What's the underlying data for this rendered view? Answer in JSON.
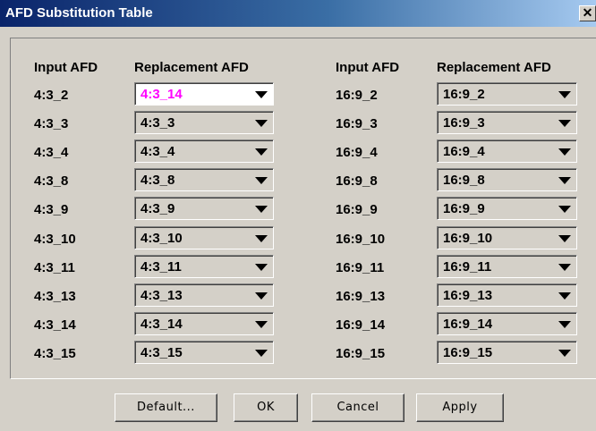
{
  "window": {
    "title": "AFD Substitution Table",
    "close_glyph": "✕"
  },
  "headers": {
    "input_afd": "Input AFD",
    "replacement_afd": "Replacement AFD"
  },
  "left_rows": [
    {
      "input": "4:3_2",
      "replacement": "4:3_14"
    },
    {
      "input": "4:3_3",
      "replacement": "4:3_3"
    },
    {
      "input": "4:3_4",
      "replacement": "4:3_4"
    },
    {
      "input": "4:3_8",
      "replacement": "4:3_8"
    },
    {
      "input": "4:3_9",
      "replacement": "4:3_9"
    },
    {
      "input": "4:3_10",
      "replacement": "4:3_10"
    },
    {
      "input": "4:3_11",
      "replacement": "4:3_11"
    },
    {
      "input": "4:3_13",
      "replacement": "4:3_13"
    },
    {
      "input": "4:3_14",
      "replacement": "4:3_14"
    },
    {
      "input": "4:3_15",
      "replacement": "4:3_15"
    }
  ],
  "right_rows": [
    {
      "input": "16:9_2",
      "replacement": "16:9_2"
    },
    {
      "input": "16:9_3",
      "replacement": "16:9_3"
    },
    {
      "input": "16:9_4",
      "replacement": "16:9_4"
    },
    {
      "input": "16:9_8",
      "replacement": "16:9_8"
    },
    {
      "input": "16:9_9",
      "replacement": "16:9_9"
    },
    {
      "input": "16:9_10",
      "replacement": "16:9_10"
    },
    {
      "input": "16:9_11",
      "replacement": "16:9_11"
    },
    {
      "input": "16:9_13",
      "replacement": "16:9_13"
    },
    {
      "input": "16:9_14",
      "replacement": "16:9_14"
    },
    {
      "input": "16:9_15",
      "replacement": "16:9_15"
    }
  ],
  "buttons": {
    "default": "Default...",
    "ok": "OK",
    "cancel": "Cancel",
    "apply": "Apply"
  },
  "colors": {
    "modified_value": "#ff00ff",
    "title_bar": "#0a246a"
  }
}
